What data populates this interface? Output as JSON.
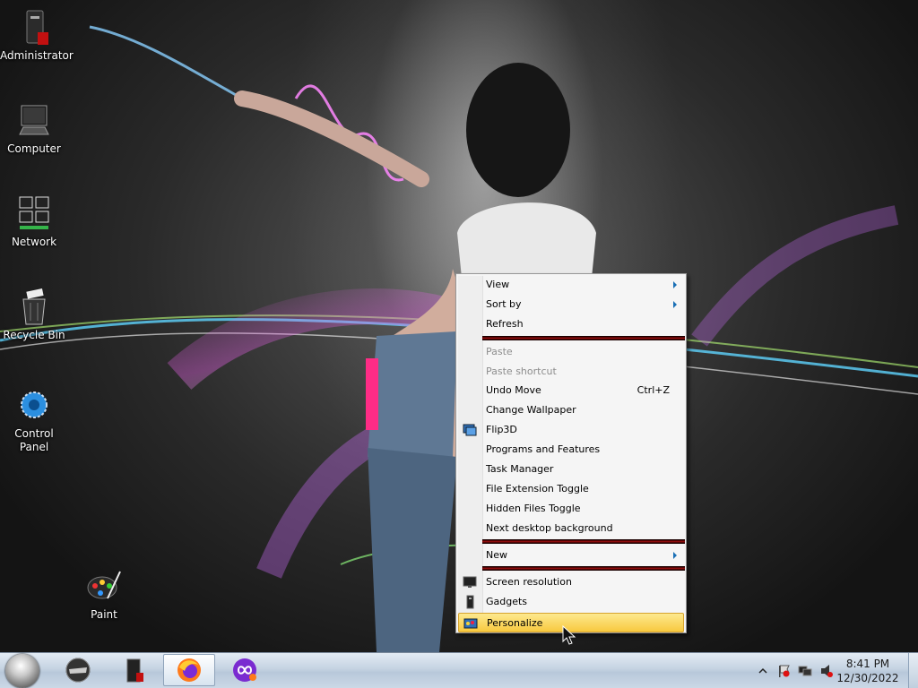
{
  "desktop": {
    "icons": [
      {
        "label": "Administrator",
        "icon": "user-folder-icon"
      },
      {
        "label": "Computer",
        "icon": "computer-icon"
      },
      {
        "label": "Network",
        "icon": "network-icon"
      },
      {
        "label": "Recycle Bin",
        "icon": "recycle-bin-icon"
      },
      {
        "label": "Control Panel",
        "icon": "control-panel-icon"
      },
      {
        "label": "Paint",
        "icon": "paint-icon"
      }
    ]
  },
  "context_menu": {
    "items": [
      {
        "label": "View",
        "submenu": true
      },
      {
        "label": "Sort by",
        "submenu": true
      },
      {
        "label": "Refresh"
      },
      {
        "label": "Paste",
        "disabled": true
      },
      {
        "label": "Paste shortcut",
        "disabled": true
      },
      {
        "label": "Undo Move",
        "shortcut": "Ctrl+Z"
      },
      {
        "label": "Change Wallpaper"
      },
      {
        "label": "Flip3D",
        "icon": "flip3d-icon"
      },
      {
        "label": "Programs and Features"
      },
      {
        "label": "Task Manager"
      },
      {
        "label": "File Extension Toggle"
      },
      {
        "label": "Hidden Files Toggle"
      },
      {
        "label": "Next desktop background"
      },
      {
        "label": "New",
        "submenu": true
      },
      {
        "label": "Screen resolution",
        "icon": "monitor-icon"
      },
      {
        "label": "Gadgets",
        "icon": "gadgets-icon"
      },
      {
        "label": "Personalize",
        "icon": "personalize-icon",
        "highlighted": true
      }
    ]
  },
  "taskbar": {
    "pinned": [
      {
        "name": "start-button",
        "icon": "start-orb-icon"
      },
      {
        "name": "taskbar-app-1",
        "icon": "helmet-icon"
      },
      {
        "name": "taskbar-app-2",
        "icon": "computer-tower-icon"
      },
      {
        "name": "taskbar-firefox",
        "icon": "firefox-icon",
        "active": true
      },
      {
        "name": "taskbar-app-4",
        "icon": "infinity-icon"
      }
    ],
    "tray": {
      "icons": [
        "show-hidden-icons-chevron",
        "action-center-flag-icon",
        "network-icon",
        "volume-icon"
      ],
      "time": "8:41 PM",
      "date": "12/30/2022"
    }
  },
  "colors": {
    "menu_highlight": "#f8c93f",
    "menu_separator": "#a01010",
    "taskbar": "#c5d3e2"
  }
}
